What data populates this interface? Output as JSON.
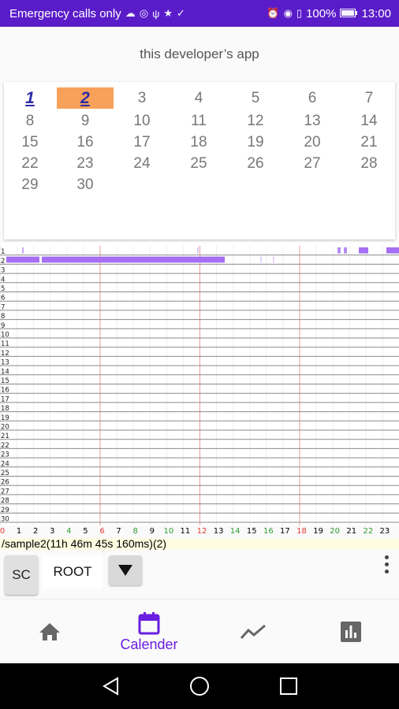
{
  "status_bar": {
    "left_text": "Emergency calls only",
    "battery": "100%",
    "time": "13:00",
    "left_icons": [
      "cloud-icon",
      "target-icon",
      "usb-icon",
      "star-icon",
      "check-circle-icon"
    ],
    "right_icons": [
      "alarm-icon",
      "eye-icon",
      "sim-icon"
    ]
  },
  "app": {
    "title": "this developer’s app"
  },
  "calendar": {
    "days": [
      "1",
      "2",
      "3",
      "4",
      "5",
      "6",
      "7",
      "8",
      "9",
      "10",
      "11",
      "12",
      "13",
      "14",
      "15",
      "16",
      "17",
      "18",
      "19",
      "20",
      "21",
      "22",
      "23",
      "24",
      "25",
      "26",
      "27",
      "28",
      "29",
      "30"
    ],
    "highlighted_days": [
      "1",
      "2"
    ],
    "selected_day": "2",
    "toolbar_icons": [
      "bar-chart-icon",
      "sort-icon"
    ]
  },
  "timeline": {
    "rows": [
      "1",
      "2",
      "3",
      "4",
      "5",
      "6",
      "7",
      "8",
      "9",
      "10",
      "11",
      "12",
      "13",
      "14",
      "15",
      "16",
      "17",
      "18",
      "19",
      "20",
      "21",
      "22",
      "23",
      "24",
      "25",
      "26",
      "27",
      "28",
      "29",
      "30"
    ],
    "hours": [
      "0",
      "1",
      "2",
      "3",
      "4",
      "5",
      "6",
      "7",
      "8",
      "9",
      "10",
      "11",
      "12",
      "13",
      "14",
      "15",
      "16",
      "17",
      "18",
      "19",
      "20",
      "21",
      "22",
      "23"
    ],
    "hour_colors": [
      "#e53935",
      "#000000",
      "#000000",
      "#000000",
      "#2e9b2e",
      "#000000",
      "#e53935",
      "#000000",
      "#2e9b2e",
      "#000000",
      "#2e9b2e",
      "#000000",
      "#e53935",
      "#000000",
      "#2e9b2e",
      "#000000",
      "#2e9b2e",
      "#000000",
      "#e53935",
      "#000000",
      "#2e9b2e",
      "#000000",
      "#2e9b2e",
      "#000000"
    ],
    "accent": "#a66ef2"
  },
  "path_text": "/sample2(11h 46m 45s 160ms)(2)",
  "controls": {
    "sc_label": "SC",
    "root_label": "ROOT"
  },
  "bottom_nav": {
    "items": [
      {
        "icon": "home-icon",
        "label": ""
      },
      {
        "icon": "calendar-icon",
        "label": "Calender"
      },
      {
        "icon": "trend-icon",
        "label": ""
      },
      {
        "icon": "bar-chart-box-icon",
        "label": ""
      }
    ],
    "active_color": "#6a1ee0",
    "inactive_color": "#666666"
  }
}
